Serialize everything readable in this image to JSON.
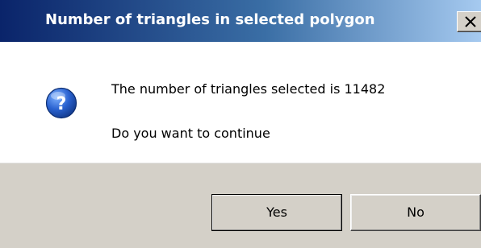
{
  "window": {
    "title": "Number of triangles in selected polygon"
  },
  "icons": {
    "close": "close-icon",
    "question": "question-icon"
  },
  "message": {
    "line1": "The number of triangles selected is 11482",
    "line2": "Do you want to continue"
  },
  "buttons": {
    "yes_label": "Yes",
    "no_label": "No"
  },
  "colors": {
    "title_bar": "#0a246a",
    "dialog_face": "#d4d0c8",
    "icon_blue": "#1c4fb0"
  }
}
